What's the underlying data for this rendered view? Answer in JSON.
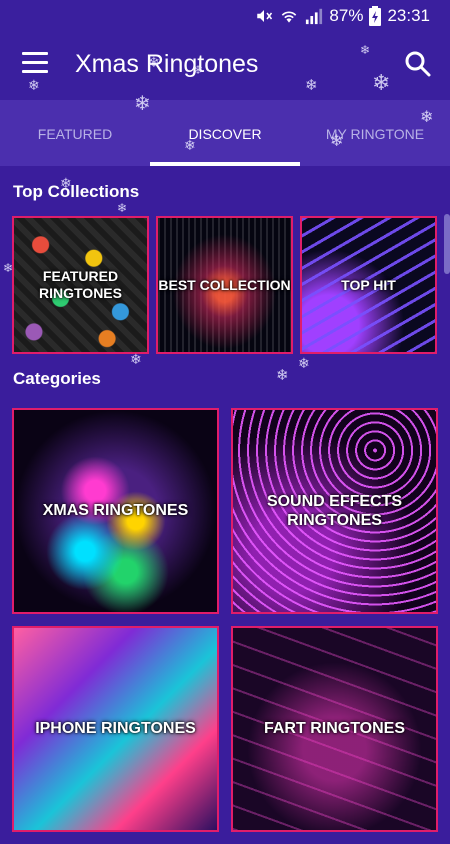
{
  "status_bar": {
    "battery_percent": "87%",
    "time": "23:31"
  },
  "app_bar": {
    "title": "Xmas Ringtones"
  },
  "tabs": [
    {
      "label": "FEATURED",
      "active": false
    },
    {
      "label": "DISCOVER",
      "active": true
    },
    {
      "label": "MY RINGTONE",
      "active": false
    }
  ],
  "sections": {
    "top_collections": {
      "title": "Top Collections",
      "items": [
        {
          "label": "FEATURED RINGTONES"
        },
        {
          "label": "BEST COLLECTION"
        },
        {
          "label": "TOP HIT"
        }
      ]
    },
    "categories": {
      "title": "Categories",
      "items": [
        {
          "label": "XMAS RINGTONES"
        },
        {
          "label": "SOUND EFFECTS RINGTONES"
        },
        {
          "label": "IPHONE RINGTONES"
        },
        {
          "label": "FART RINGTONES"
        }
      ]
    }
  },
  "colors": {
    "background": "#3a1d9c",
    "app_bar": "#3a1f9e",
    "tab_bar": "#4b2fae",
    "card_border": "#e01d6a",
    "tab_inactive_text": "#b8b2e6"
  },
  "icons": {
    "status": [
      "mute-icon",
      "wifi-icon",
      "signal-icon",
      "battery-icon"
    ],
    "menu": "hamburger-menu-icon",
    "search": "search-icon",
    "decoration": "snowflake-icon"
  }
}
